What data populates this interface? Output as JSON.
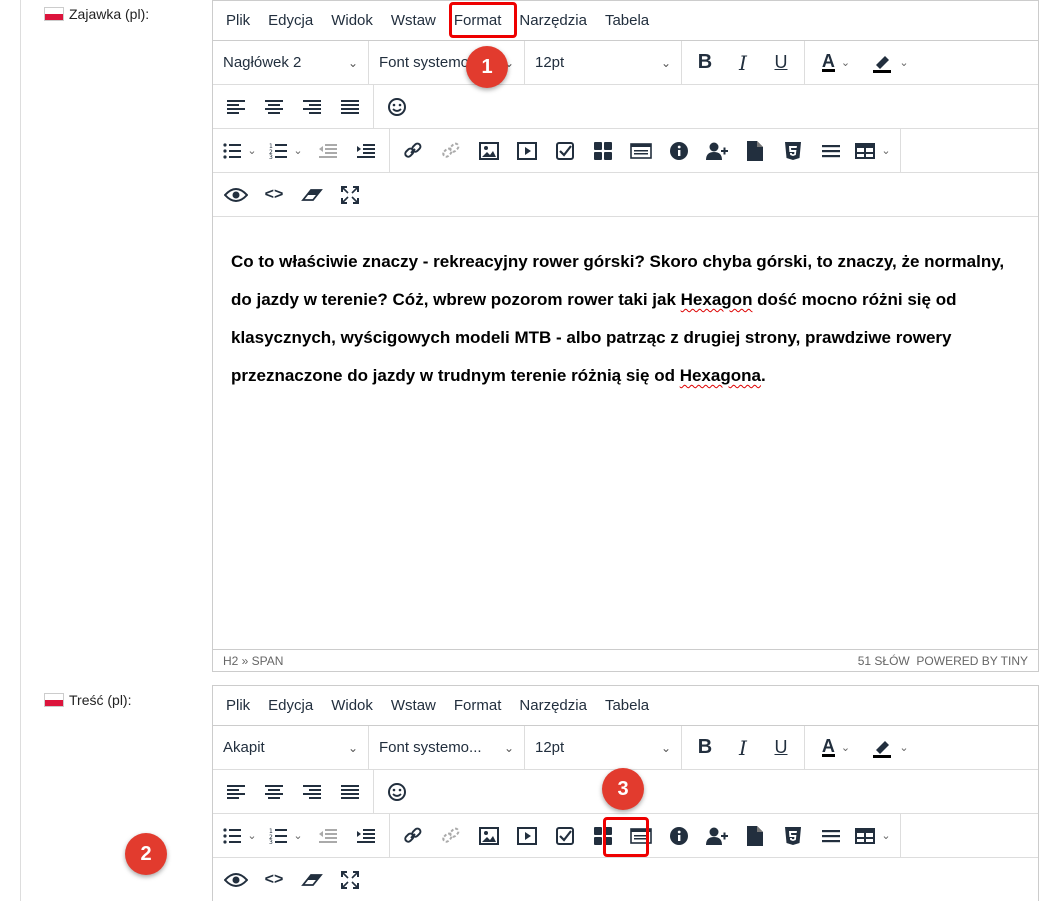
{
  "fields": [
    {
      "label": "Zajawka (pl):",
      "menu": [
        "Plik",
        "Edycja",
        "Widok",
        "Wstaw",
        "Format",
        "Narzędzia",
        "Tabela"
      ],
      "block_format": "Nagłówek 2",
      "font_family": "Font systemo...",
      "font_size": "12pt",
      "content_parts": [
        "Co to właściwie znaczy - rekreacyjny rower górski? Skoro chyba górski, to znaczy, że normalny, do jazdy w terenie? Cóż, wbrew pozorom rower taki jak ",
        "Hexagon",
        " dość mocno różni się od klasycznych, wyścigowych modeli MTB - albo patrząc z drugiej strony, prawdziwe rowery przeznaczone do jazdy w trudnym terenie różnią się od ",
        "Hexagona",
        "."
      ],
      "status_path": "H2 » SPAN",
      "status_right": "51 SŁÓW  POWERED BY TINY"
    },
    {
      "label": "Treść (pl):",
      "menu": [
        "Plik",
        "Edycja",
        "Widok",
        "Wstaw",
        "Format",
        "Narzędzia",
        "Tabela"
      ],
      "block_format": "Akapit",
      "font_family": "Font systemo...",
      "font_size": "12pt"
    }
  ],
  "badges": [
    "1",
    "2",
    "3"
  ],
  "colors": {
    "highlight": "#e00000",
    "badge": "#e23b2e",
    "border": "#cccccc"
  },
  "icons": {
    "row2": [
      "bold-icon",
      "italic-icon",
      "underline-icon",
      "text-color-icon",
      "highlight-color-icon"
    ],
    "row3": [
      "align-left-icon",
      "align-center-icon",
      "align-right-icon",
      "align-justify-icon",
      "emoticons-icon"
    ],
    "row4": [
      "bullet-list-icon",
      "numbered-list-icon",
      "outdent-icon",
      "indent-icon",
      "link-icon",
      "unlink-icon",
      "image-icon",
      "media-icon",
      "checklist-icon",
      "template-grid-icon",
      "code-sample-icon",
      "info-icon",
      "add-user-icon",
      "document-icon",
      "html5-icon",
      "horizontal-rule-icon",
      "table-icon"
    ],
    "row5": [
      "preview-icon",
      "source-code-icon",
      "remove-format-icon",
      "fullscreen-icon"
    ]
  }
}
